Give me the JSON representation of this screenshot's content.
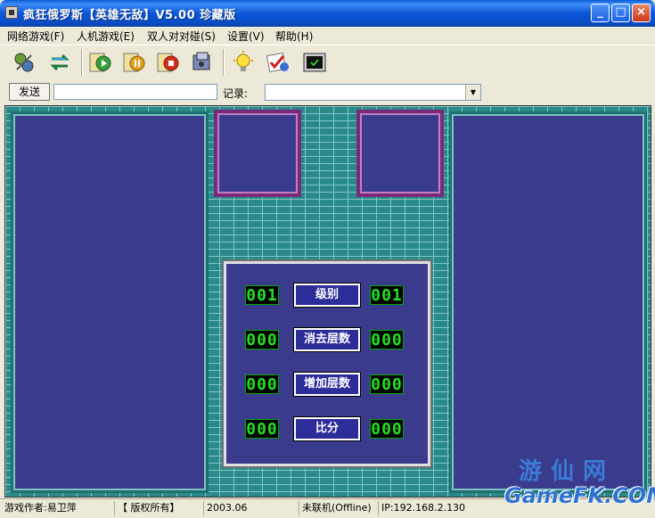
{
  "window": {
    "title": "疯狂俄罗斯【英雄无敌】V5.00 珍藏版",
    "minimize": "_",
    "maximize": "□",
    "close": "×"
  },
  "menu": [
    {
      "label": "网络游戏(F)"
    },
    {
      "label": "人机游戏(E)"
    },
    {
      "label": "双人对对碰(S)"
    },
    {
      "label": "设置(V)"
    },
    {
      "label": "帮助(H)"
    }
  ],
  "toolbar": {
    "icons": [
      "connect-icon",
      "swap-icon",
      "start-icon",
      "pause-icon",
      "stop-icon",
      "sound-icon",
      "hint-icon",
      "check-icon",
      "screen-icon"
    ]
  },
  "send": {
    "button": "发送",
    "input_value": "",
    "record_label": "记录:",
    "record_value": ""
  },
  "panel": {
    "level_label": "级别",
    "lines_label": "消去层数",
    "added_label": "增加层数",
    "score_label": "比分",
    "left": {
      "level": "001",
      "lines": "000",
      "added": "000",
      "score": "000"
    },
    "right": {
      "level": "001",
      "lines": "000",
      "added": "000",
      "score": "000"
    }
  },
  "statusbar": {
    "author": "游戏作者:易卫萍",
    "copyright": "【 版权所有】",
    "year": "2003.06",
    "connection": "未联机(Offline)",
    "ip": "IP:192.168.2.130"
  },
  "watermark": {
    "cn": "游仙网",
    "en": "GameFK.COM"
  },
  "colors": {
    "board": "#3b3b8e",
    "brick": "#2a8a8a",
    "digits": "#22e022",
    "preview_frame": "#7a2a7a"
  }
}
